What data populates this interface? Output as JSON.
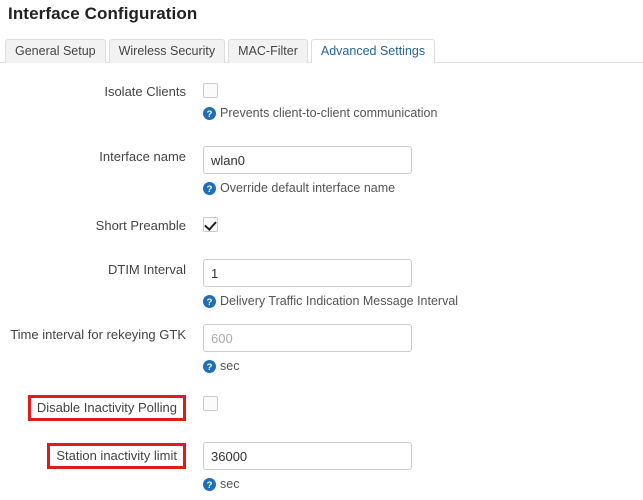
{
  "page": {
    "title": "Interface Configuration"
  },
  "tabs": [
    {
      "label": "General Setup",
      "active": false
    },
    {
      "label": "Wireless Security",
      "active": false
    },
    {
      "label": "MAC-Filter",
      "active": false
    },
    {
      "label": "Advanced Settings",
      "active": true
    }
  ],
  "colors": {
    "accent_blue": "#2a6496",
    "help_icon_blue": "#1f6fb8",
    "annotation_red": "#e01b1b",
    "border_grey": "#cccccc",
    "tab_inactive_bg": "#f2f2f2"
  },
  "icons": {
    "help": "help-circle-icon",
    "checkmark": "checkmark-icon"
  },
  "form": {
    "rows": [
      {
        "label": "Isolate Clients",
        "type": "checkbox",
        "checked": false,
        "highlight": false,
        "help": "Prevents client-to-client communication"
      },
      {
        "label": "Interface name",
        "type": "text",
        "value": "wlan0",
        "placeholder": "",
        "highlight": false,
        "help": "Override default interface name"
      },
      {
        "label": "Short Preamble",
        "type": "checkbox",
        "checked": true,
        "highlight": false,
        "help": ""
      },
      {
        "label": "DTIM Interval",
        "type": "text",
        "value": "1",
        "placeholder": "",
        "highlight": false,
        "help": "Delivery Traffic Indication Message Interval"
      },
      {
        "label": "Time interval for rekeying GTK",
        "type": "text",
        "value": "",
        "placeholder": "600",
        "highlight": false,
        "help": "sec"
      },
      {
        "label": "Disable Inactivity Polling",
        "type": "checkbox",
        "checked": false,
        "highlight": true,
        "help": ""
      },
      {
        "label": "Station inactivity limit",
        "type": "text",
        "value": "36000",
        "placeholder": "",
        "highlight": true,
        "help": "sec"
      }
    ]
  }
}
